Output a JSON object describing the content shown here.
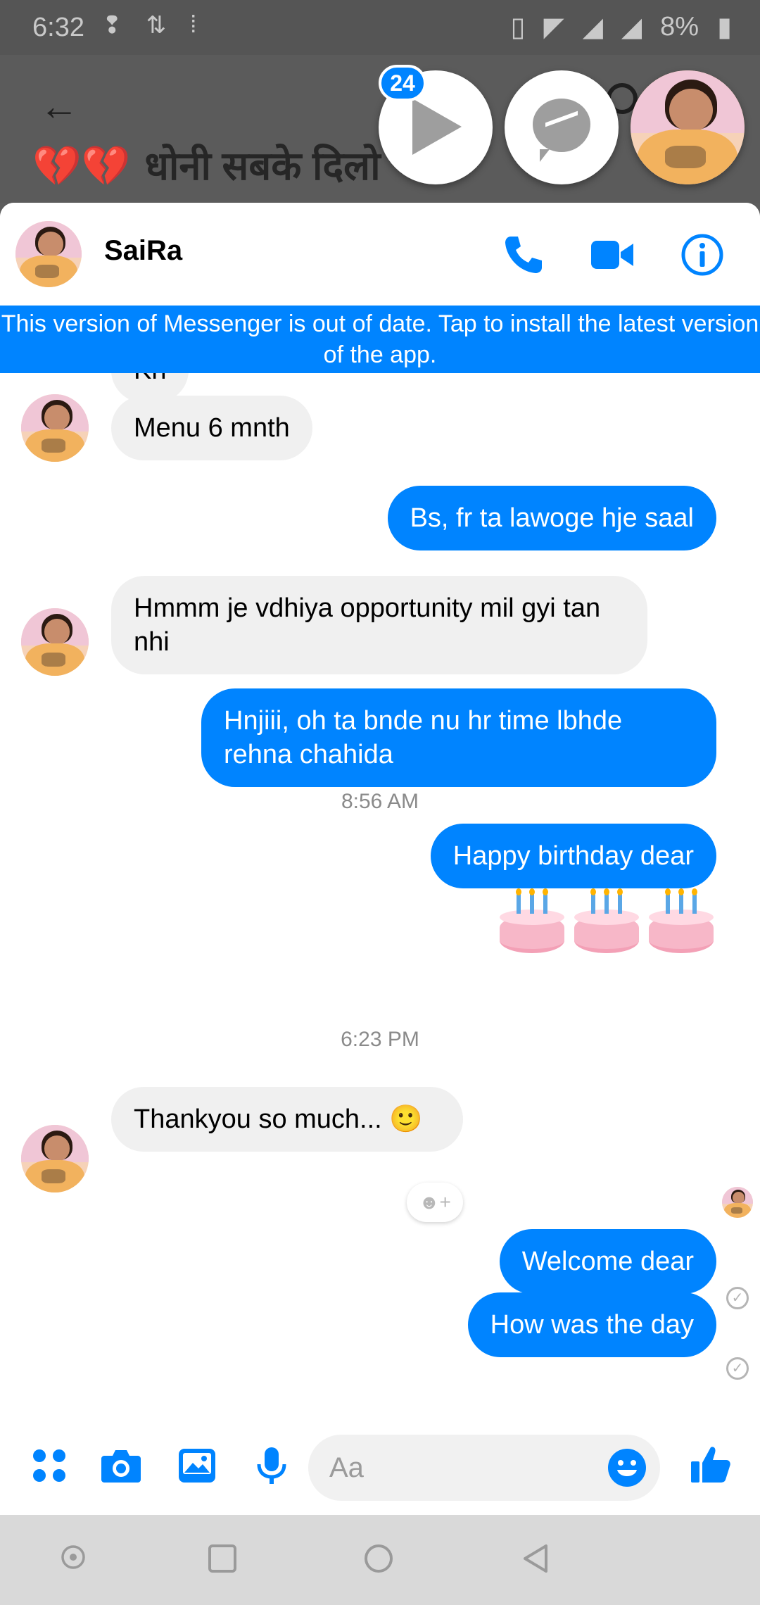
{
  "status_bar": {
    "time": "6:32",
    "battery": "8%"
  },
  "background_app": {
    "title_hearts": "💔💔",
    "title_text": "धोनी सबके दिलो"
  },
  "chat_heads": {
    "badge_count": "24"
  },
  "header": {
    "contact_name": "SaiRa"
  },
  "update_banner": {
    "text": "This version of Messenger is out of date. Tap to install the latest version of the app."
  },
  "messages": [
    {
      "id": "m0",
      "sender": "them",
      "text": "Kh"
    },
    {
      "id": "m1",
      "sender": "them",
      "text": "Menu 6 mnth"
    },
    {
      "id": "m2",
      "sender": "me",
      "text": "Bs, fr ta lawoge hje saal"
    },
    {
      "id": "m3",
      "sender": "them",
      "text": "Hmmm je vdhiya opportunity mil gyi tan nhi"
    },
    {
      "id": "m4",
      "sender": "me",
      "text": "Hnjiii, oh ta bnde nu hr time lbhde rehna chahida"
    },
    {
      "id": "m5",
      "sender": "me",
      "text": "Happy birthday dear"
    },
    {
      "id": "m6",
      "sender": "me",
      "text": "Welcome dear"
    },
    {
      "id": "m7",
      "sender": "me",
      "text": "How was the day"
    },
    {
      "id": "m8",
      "sender": "them",
      "text": "Thankyou so much... 🙂"
    }
  ],
  "timestamps": {
    "t1": "8:56 AM",
    "t2": "6:23 PM"
  },
  "cake_emoji_count": 3,
  "reaction_button": "☻+",
  "composer": {
    "placeholder": "Aa"
  },
  "colors": {
    "accent": "#0084ff",
    "incoming_bubble": "#f0f0f0",
    "status_bar": "#555555",
    "nav_bar": "#d9d9d9"
  },
  "icons": [
    "back-arrow-icon",
    "search-icon",
    "play-icon",
    "messenger-icon",
    "phone-icon",
    "video-camera-icon",
    "info-icon",
    "apps-icon",
    "camera-icon",
    "gallery-icon",
    "microphone-icon",
    "emoji-icon",
    "thumbs-up-icon",
    "home-icon",
    "recents-icon",
    "back-icon"
  ]
}
